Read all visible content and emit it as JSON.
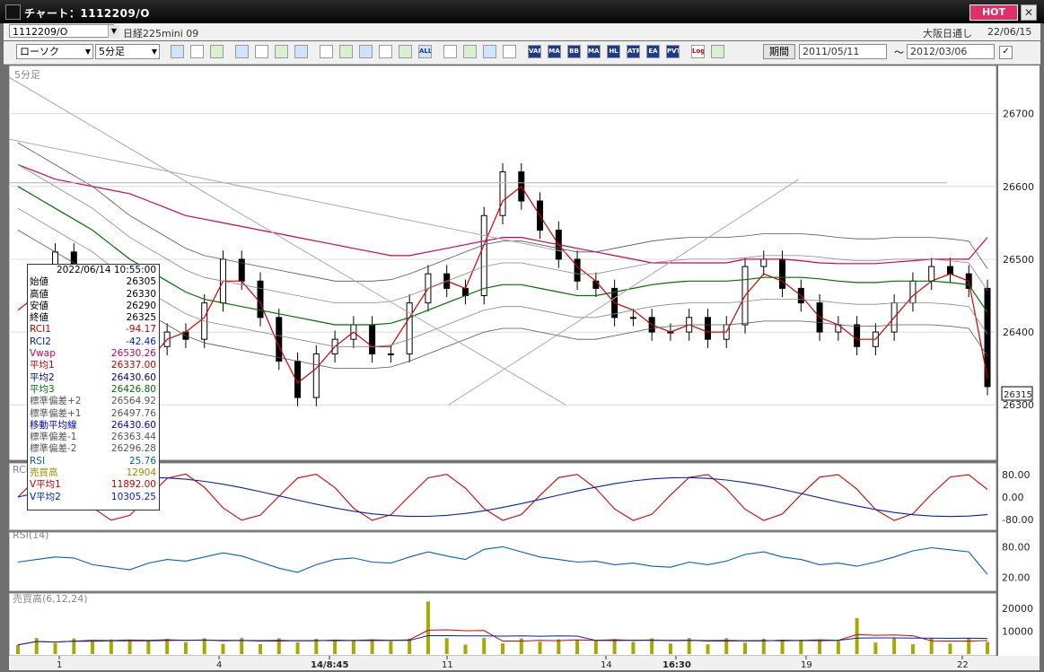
{
  "titlebar": {
    "title": "チャート：1112209/O",
    "hot_label": "HOT",
    "close_glyph": "✕"
  },
  "header": {
    "symbol": "1112209/O",
    "name": "日経225mini 09",
    "exchange": "大阪日通し",
    "date": "22/06/15"
  },
  "toolbar": {
    "chart_type": "ローソク",
    "interval": "5分足",
    "period_label": "期間",
    "date_from": "2011/05/11",
    "date_sep": "～",
    "date_to": "2012/03/06",
    "icons": [
      "zoom-icon",
      "grid-icon",
      "candle-icon",
      "zoom-in-icon",
      "bar-chart-icon",
      "crosshair-icon",
      "info-icon",
      "pen-icon",
      "cursor-icon",
      "redo-icon",
      "candle-split-icon",
      "candle-del-icon",
      "all-icon",
      "settings-icon",
      "brush-icon",
      "color-icon",
      "grid-toggle-icon",
      "vap-icon",
      "ma-icon",
      "bb-icon",
      "mae-icon",
      "hl-icon",
      "atr-icon",
      "ea-icon",
      "pvt-icon",
      "log-icon",
      "save-icon"
    ],
    "labels": {
      "vap": "VAP",
      "ma": "MA",
      "bb": "BB",
      "mae": "MAE",
      "hl": "HL",
      "atr": "ATR",
      "ea": "EA",
      "pvt": "PVT",
      "log": "Log",
      "all": "ALL"
    }
  },
  "panels": {
    "main_label": "5分足",
    "rci_label": "RCI",
    "rsi_label": "RSI(14)",
    "vol_label": "売買高(6,12,24)",
    "current_price": "26315"
  },
  "axes": {
    "price_ticks": [
      "26700",
      "26600",
      "26500",
      "26400",
      "26300"
    ],
    "rci_ticks": [
      "80.00",
      "0.00",
      "-80.00"
    ],
    "rsi_ticks": [
      "80.00",
      "20.00"
    ],
    "vol_ticks": [
      "20000",
      "10000"
    ],
    "x_ticks": [
      "1",
      "4",
      "14/8:45",
      "11",
      "14",
      "16:30",
      "19",
      "22"
    ]
  },
  "databox": {
    "datetime": "2022/06/14    10:55:00",
    "rows": [
      {
        "label": "始値",
        "value": "26305",
        "color": "#000000"
      },
      {
        "label": "高値",
        "value": "26330",
        "color": "#000000"
      },
      {
        "label": "安値",
        "value": "26290",
        "color": "#000000"
      },
      {
        "label": "終値",
        "value": "26325",
        "color": "#000000"
      },
      {
        "label": "RCI1",
        "value": "-94.17",
        "color": "#c00000"
      },
      {
        "label": "RCI2",
        "value": "-42.46",
        "color": "#0020c0"
      },
      {
        "label": "Vwap",
        "value": "26530.26",
        "color": "#d00050"
      },
      {
        "label": "平均1",
        "value": "26337.00",
        "color": "#c00000"
      },
      {
        "label": "平均2",
        "value": "26430.60",
        "color": "#000080"
      },
      {
        "label": "平均3",
        "value": "26426.80",
        "color": "#007000"
      },
      {
        "label": "標準偏差+2",
        "value": "26564.92",
        "color": "#555555"
      },
      {
        "label": "標準偏差+1",
        "value": "26497.76",
        "color": "#555555"
      },
      {
        "label": "移動平均線",
        "value": "26430.60",
        "color": "#0000c0"
      },
      {
        "label": "標準偏差-1",
        "value": "26363.44",
        "color": "#555555"
      },
      {
        "label": "標準偏差-2",
        "value": "26296.28",
        "color": "#555555"
      },
      {
        "label": "RSI",
        "value": "25.76",
        "color": "#0060c0"
      },
      {
        "label": "売買高",
        "value": "12904",
        "color": "#909000"
      },
      {
        "label": "V平均1",
        "value": "11892.00",
        "color": "#c00000"
      },
      {
        "label": "V平均2",
        "value": "10305.25",
        "color": "#0020c0"
      }
    ]
  },
  "chart_data": {
    "type": "line",
    "title": "",
    "xlabel": "",
    "ylabel": "",
    "ylim": [
      26230,
      26760
    ],
    "x_ticks": [
      "1",
      "4",
      "14/8:45",
      "11",
      "14",
      "16:30",
      "19",
      "22"
    ],
    "series": [
      {
        "name": "終値",
        "values": [
          26420,
          26460,
          26510,
          26470,
          26440,
          26400,
          26330,
          26380,
          26400,
          26390,
          26440,
          26500,
          26470,
          26420,
          26360,
          26310,
          26370,
          26390,
          26410,
          26370,
          26370,
          26440,
          26480,
          26460,
          26450,
          26560,
          26620,
          26580,
          26540,
          26500,
          26470,
          26460,
          26420,
          26420,
          26400,
          26400,
          26420,
          26390,
          26410,
          26490,
          26500,
          26460,
          26440,
          26400,
          26410,
          26380,
          26400,
          26440,
          26470,
          26490,
          26480,
          26460,
          26325
        ]
      },
      {
        "name": "平均1",
        "values": [
          26430,
          26450,
          26480,
          26480,
          26450,
          26410,
          26360,
          26360,
          26390,
          26400,
          26420,
          26470,
          26470,
          26440,
          26380,
          26330,
          26350,
          26380,
          26400,
          26380,
          26380,
          26420,
          26460,
          26470,
          26460,
          26520,
          26580,
          26600,
          26560,
          26520,
          26490,
          26470,
          26440,
          26430,
          26410,
          26400,
          26410,
          26400,
          26400,
          26450,
          26480,
          26470,
          26450,
          26420,
          26410,
          26390,
          26390,
          26420,
          26450,
          26470,
          26480,
          26470,
          26337
        ]
      },
      {
        "name": "Vwap",
        "values": [
          26630,
          26620,
          26610,
          26605,
          26600,
          26595,
          26590,
          26580,
          26570,
          26560,
          26555,
          26550,
          26545,
          26540,
          26535,
          26530,
          26525,
          26520,
          26515,
          26510,
          26505,
          26505,
          26510,
          26515,
          26520,
          26525,
          26530,
          26530,
          26525,
          26520,
          26515,
          26510,
          26505,
          26500,
          26495,
          26495,
          26495,
          26495,
          26495,
          26500,
          26500,
          26500,
          26498,
          26495,
          26494,
          26494,
          26494,
          26496,
          26498,
          26500,
          26500,
          26500,
          26530
        ]
      },
      {
        "name": "平均3",
        "values": [
          26600,
          26585,
          26570,
          26555,
          26540,
          26520,
          26500,
          26485,
          26470,
          26455,
          26445,
          26440,
          26435,
          26430,
          26425,
          26420,
          26415,
          26410,
          26410,
          26410,
          26412,
          26420,
          26430,
          26440,
          26450,
          26460,
          26465,
          26465,
          26460,
          26455,
          26450,
          26450,
          26455,
          26460,
          26465,
          26468,
          26470,
          26470,
          26470,
          26472,
          26475,
          26475,
          26475,
          26473,
          26470,
          26468,
          26468,
          26470,
          26470,
          26470,
          26468,
          26465,
          26427
        ]
      },
      {
        "name": "RSI",
        "values": [
          50,
          55,
          60,
          58,
          45,
          40,
          35,
          48,
          55,
          52,
          60,
          68,
          62,
          50,
          38,
          30,
          45,
          55,
          58,
          50,
          48,
          60,
          70,
          62,
          55,
          75,
          80,
          70,
          60,
          55,
          50,
          52,
          45,
          48,
          42,
          40,
          50,
          45,
          52,
          65,
          70,
          60,
          55,
          45,
          48,
          42,
          50,
          60,
          72,
          78,
          74,
          70,
          26
        ]
      }
    ]
  }
}
